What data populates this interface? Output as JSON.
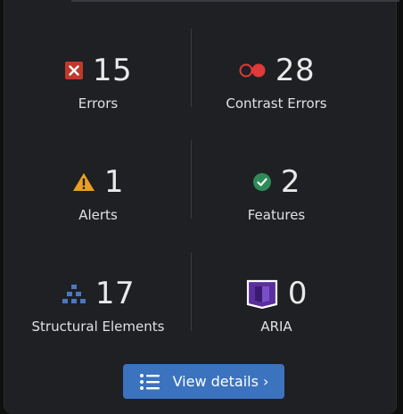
{
  "metrics": [
    {
      "count": "15",
      "label": "Errors",
      "icon": "error-x-icon",
      "color": "#c0392b"
    },
    {
      "count": "28",
      "label": "Contrast Errors",
      "icon": "contrast-circles-icon",
      "color": "#e03a3a"
    },
    {
      "count": "1",
      "label": "Alerts",
      "icon": "alert-triangle-icon",
      "color": "#e89f22"
    },
    {
      "count": "2",
      "label": "Features",
      "icon": "checkmark-circle-icon",
      "color": "#2e8b57"
    },
    {
      "count": "17",
      "label": "Structural Elements",
      "icon": "hierarchy-icon",
      "color": "#4a78c0"
    },
    {
      "count": "0",
      "label": "ARIA",
      "icon": "aria-shape-icon",
      "color": "#5b2ea0"
    }
  ],
  "button": {
    "label": "View details ›",
    "icon": "list-icon",
    "color": "#3b73bf"
  }
}
